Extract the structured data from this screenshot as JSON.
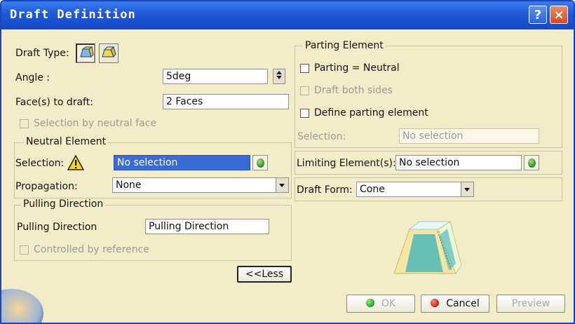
{
  "window": {
    "title": "Draft Definition",
    "help_label": "?",
    "close_label": "×"
  },
  "left": {
    "draft_type_label": "Draft Type:",
    "angle_label": "Angle :",
    "angle_value": "5deg",
    "faces_label": "Face(s) to draft:",
    "faces_value": "2 Faces",
    "selection_by_neutral_face": "Selection by neutral face",
    "neutral_element": {
      "legend": "Neutral Element",
      "selection_label": "Selection:",
      "selection_value": "No selection",
      "propagation_label": "Propagation:",
      "propagation_value": "None"
    },
    "pulling_direction": {
      "legend": "Pulling Direction",
      "label": "Pulling Direction",
      "value": "Pulling Direction",
      "controlled_by_reference": "Controlled by reference"
    },
    "less_button": "<<Less"
  },
  "right": {
    "parting_element": {
      "legend": "Parting Element",
      "parting_neutral": "Parting = Neutral",
      "draft_both_sides": "Draft both sides",
      "define_parting": "Define parting element",
      "selection_label": "Selection:",
      "selection_value": "No selection"
    },
    "limiting_label": "Limiting Element(s):",
    "limiting_value": "No selection",
    "draft_form_label": "Draft Form:",
    "draft_form_value": "Cone"
  },
  "buttons": {
    "ok": "OK",
    "cancel": "Cancel",
    "preview": "Preview"
  },
  "colors": {
    "dialog_bg": "#f3ecc9",
    "title_bar": "#1f58d8",
    "selection_highlight": "#3a6ad3"
  }
}
